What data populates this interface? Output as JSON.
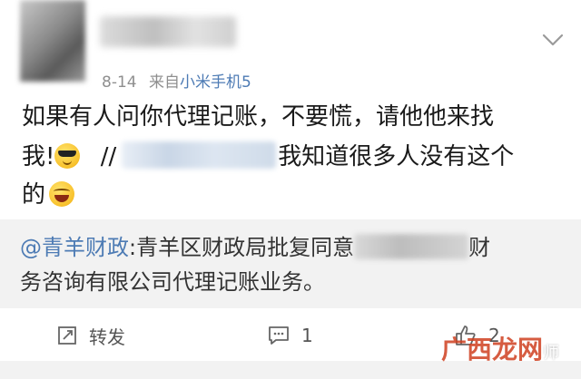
{
  "post": {
    "meta": {
      "date": "8-14",
      "source_prefix": "来自",
      "device": "小米手机5"
    },
    "lines": {
      "l1": "如果有人问你代理记账，不要慌，请他他来找",
      "l2_before": "我!",
      "l2_slashes": "//",
      "l2_after": "我知道很多人没有这个",
      "l3": "的"
    },
    "emojis": [
      "cool-emoji",
      "laugh-emoji"
    ]
  },
  "repost": {
    "user": "@青羊财政",
    "colon": ":",
    "text_1": "青羊区财政局批复同意",
    "text_1_tail": "财",
    "text_2": "务咨询有限公司代理记账业务。"
  },
  "actions": {
    "repost_label": "转发",
    "comment_count": "1",
    "like_count": "2"
  },
  "watermark": {
    "text": "广西龙网",
    "tail": "师"
  },
  "colors": {
    "link": "#4d7bb4",
    "meta_gray": "#8f8f8f",
    "repost_bg": "#f2f2f2"
  }
}
